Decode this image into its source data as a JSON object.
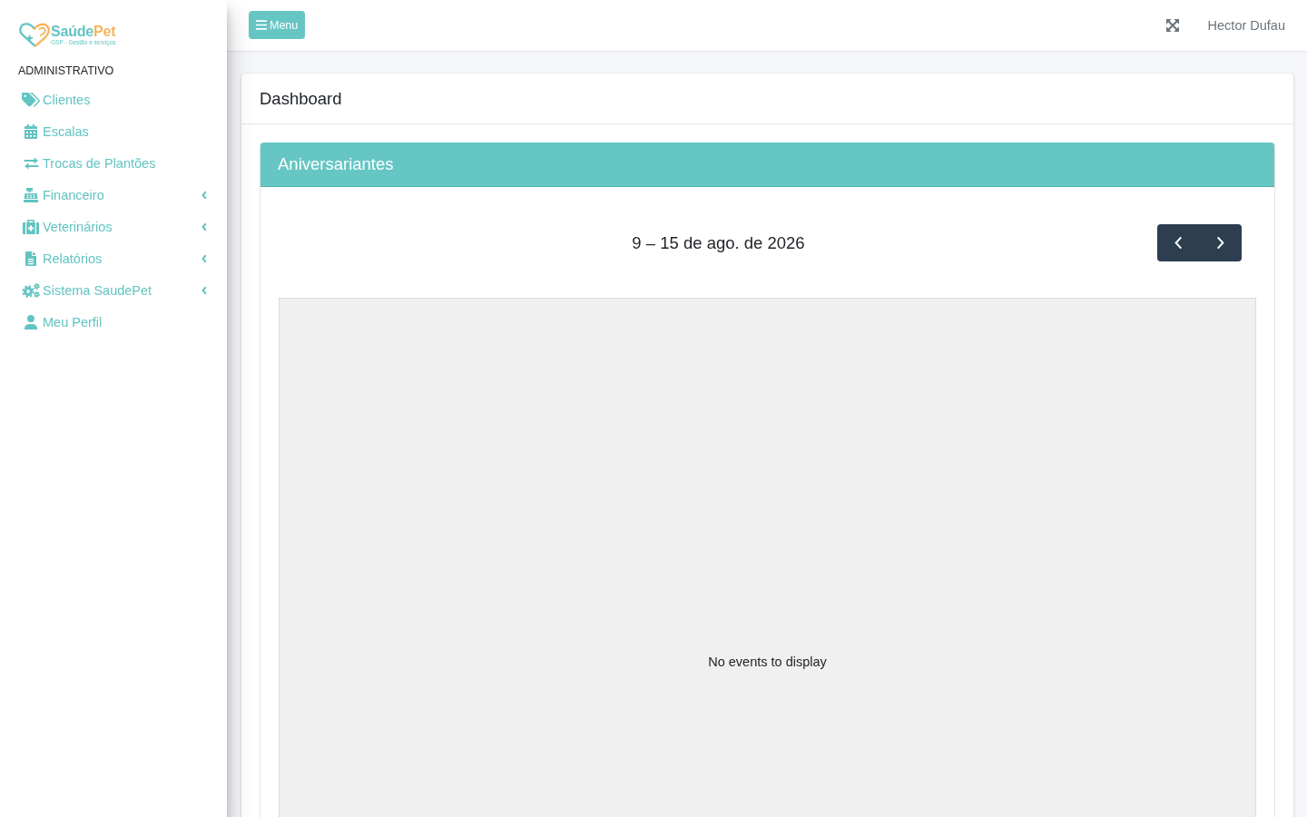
{
  "sidebar": {
    "logo": {
      "name": "Saúde",
      "name_accent": "Pet",
      "tagline": "GSP - Gestão e serviços"
    },
    "section_title": "ADMINISTRATIVO",
    "items": [
      {
        "label": "Clientes",
        "expandable": false
      },
      {
        "label": "Escalas",
        "expandable": false
      },
      {
        "label": "Trocas de Plantões",
        "expandable": false
      },
      {
        "label": "Financeiro",
        "expandable": true
      },
      {
        "label": "Veterinários",
        "expandable": true
      },
      {
        "label": "Relatórios",
        "expandable": true
      },
      {
        "label": "Sistema SaudePet",
        "expandable": true
      },
      {
        "label": "Meu Perfil",
        "expandable": false
      }
    ]
  },
  "navbar": {
    "menu_button": "Menu",
    "user_name": "Hector Dufau"
  },
  "page": {
    "title": "Dashboard",
    "panel": {
      "title": "Aniversariantes",
      "calendar": {
        "date_range": "9 – 15 de ago. de 2026",
        "empty_message": "No events to display"
      }
    }
  }
}
